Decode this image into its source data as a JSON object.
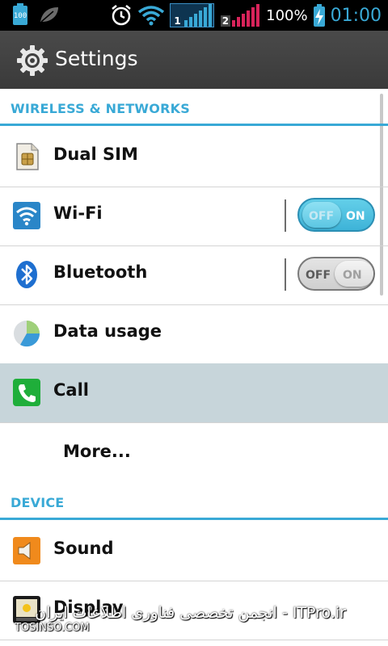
{
  "status_bar": {
    "battery_small_label": "100",
    "sim1_label": "1",
    "sim2_label": "2",
    "battery_percent": "100%",
    "time": "01:00"
  },
  "header": {
    "title": "Settings"
  },
  "sections": {
    "wireless": {
      "label": "WIRELESS & NETWORKS",
      "items": [
        {
          "label": "Dual SIM",
          "icon": "sim-card-icon"
        },
        {
          "label": "Wi-Fi",
          "icon": "wifi-icon",
          "toggle": {
            "state": "on",
            "off_label": "OFF",
            "on_label": "ON"
          }
        },
        {
          "label": "Bluetooth",
          "icon": "bluetooth-icon",
          "toggle": {
            "state": "off",
            "off_label": "OFF",
            "on_label": "ON"
          }
        },
        {
          "label": "Data usage",
          "icon": "data-usage-icon"
        },
        {
          "label": "Call",
          "icon": "phone-icon",
          "selected": true
        },
        {
          "label": "More..."
        }
      ]
    },
    "device": {
      "label": "DEVICE",
      "items": [
        {
          "label": "Sound",
          "icon": "speaker-icon"
        },
        {
          "label": "Display",
          "icon": "display-icon"
        }
      ]
    }
  },
  "watermark": {
    "right_text": "ITPro.ir - انجمن تخصصی فناوری اطلاعات ایران",
    "left_text": "TOSINSO.COM"
  },
  "colors": {
    "accent": "#39a9d6",
    "selected_row": "#c7d5da",
    "title_bar": "#404040"
  }
}
